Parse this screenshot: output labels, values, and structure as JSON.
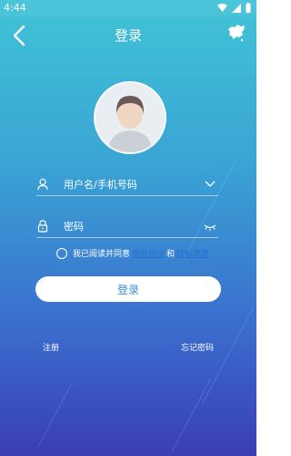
{
  "status_bar": {
    "time": "4:44"
  },
  "header": {
    "title": "登录"
  },
  "form": {
    "username_placeholder": "用户名/手机号码",
    "password_placeholder": "密码"
  },
  "agreement": {
    "prefix": "我已阅读并同意",
    "service_link": "服务协议",
    "and": "和",
    "privacy_link": "隐私政策"
  },
  "actions": {
    "login": "登录",
    "register": "注册",
    "forgot_password": "忘记密码"
  },
  "colors": {
    "gradient_top": "#40c3d6",
    "gradient_bottom": "#3a3eb2",
    "link": "#2a6fd6",
    "button_text": "#3a8fd4"
  }
}
